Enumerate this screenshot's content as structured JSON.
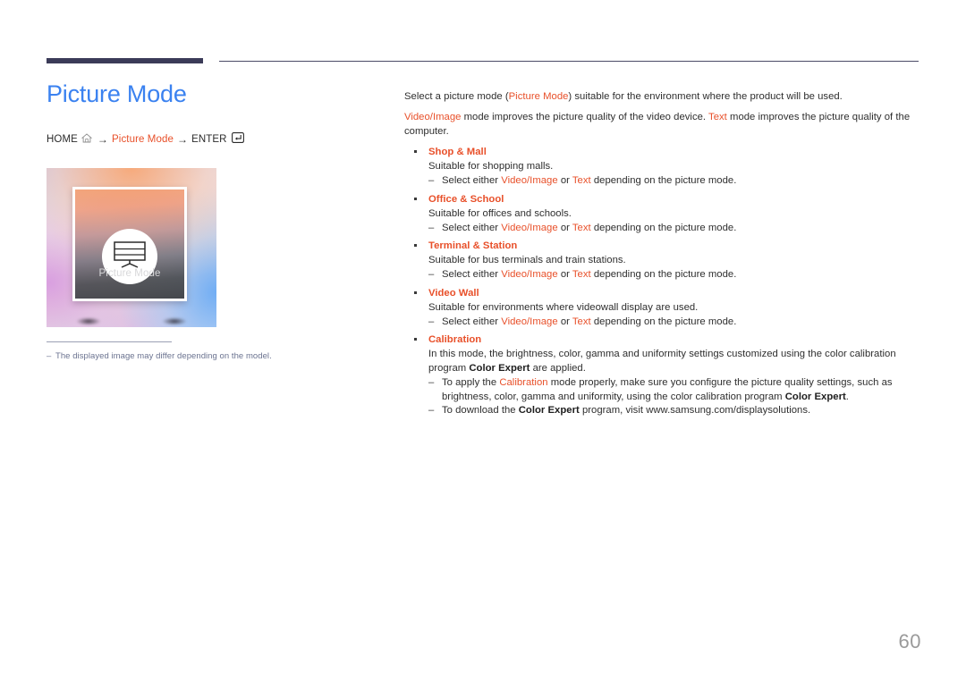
{
  "document": {
    "page_number": "60"
  },
  "colors": {
    "title_blue": "#3b82f0",
    "highlight_orange": "#e8502a",
    "rule_navy": "#3b3b58",
    "note_gray_blue": "#6b7390",
    "page_number_gray": "#9a9a9a"
  },
  "left": {
    "title": "Picture Mode",
    "breadcrumb": {
      "home_label": "HOME",
      "home_icon": "home-icon",
      "arrow1": "→",
      "menu_label": "Picture Mode",
      "arrow2": "→",
      "enter_label": "ENTER",
      "enter_icon": "enter-key-icon"
    },
    "figure": {
      "caption": "Picture Mode",
      "icon": "display-monitor-icon"
    },
    "note": {
      "dash": "–",
      "text": "The displayed image may differ depending on the model."
    }
  },
  "right": {
    "intro": {
      "p1_a": "Select a picture mode (",
      "p1_hl": "Picture Mode",
      "p1_b": ") suitable for the environment where the product will be used.",
      "p2_hl1": "Video/Image",
      "p2_a": " mode improves the picture quality of the video device. ",
      "p2_hl2": "Text",
      "p2_b": " mode improves the picture quality of the computer."
    },
    "common": {
      "select_either_prefix": "Select either ",
      "video_image": "Video/Image",
      "or": " or ",
      "text": "Text",
      "select_either_suffix": " depending on the picture mode."
    },
    "modes": [
      {
        "name": "Shop & Mall",
        "description": "Suitable for shopping malls.",
        "has_select_note": true
      },
      {
        "name": "Office & School",
        "description": "Suitable for offices and schools.",
        "has_select_note": true
      },
      {
        "name": "Terminal & Station",
        "description": "Suitable for bus terminals and train stations.",
        "has_select_note": true
      },
      {
        "name": "Video Wall",
        "description": "Suitable for environments where videowall display are used.",
        "has_select_note": true
      }
    ],
    "calibration": {
      "name": "Calibration",
      "desc_a": "In this mode, the brightness, color, gamma and uniformity settings customized using the color calibration program ",
      "desc_bold": "Color Expert",
      "desc_b": " are applied.",
      "sub1_a": "To apply the ",
      "sub1_hl": "Calibration",
      "sub1_b": " mode properly, make sure you configure the picture quality settings, such as brightness, color, gamma and uniformity, using the color calibration program ",
      "sub1_bold": "Color Expert",
      "sub1_c": ".",
      "sub2_a": "To download the ",
      "sub2_bold": "Color Expert",
      "sub2_b": " program, visit www.samsung.com/displaysolutions."
    }
  }
}
